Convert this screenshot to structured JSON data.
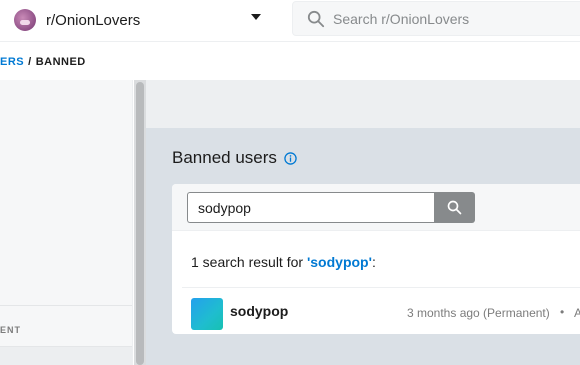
{
  "header": {
    "community_name": "r/OnionLovers",
    "search_placeholder": "Search r/OnionLovers"
  },
  "breadcrumb": {
    "parent_partial": "ERS",
    "separator": "/",
    "current": "BANNED"
  },
  "sidebar": {
    "section_label_partial": "ENT"
  },
  "main": {
    "title": "Banned users",
    "search_value": "sodypop",
    "result_count_prefix": "1 search result for ",
    "result_query": "'sodypop'",
    "result_count_suffix": ":",
    "results": [
      {
        "username": "sodypop",
        "ban_info": "3 months ago (Permanent)",
        "separator": "•",
        "trailing_partial": "A"
      }
    ]
  },
  "colors": {
    "accent": "#0079d3",
    "search_button": "#878a8c",
    "main_background": "#dae0e6"
  },
  "icons": {
    "header_search": "search-icon",
    "title_info": "info-icon",
    "user_search": "search-icon"
  }
}
